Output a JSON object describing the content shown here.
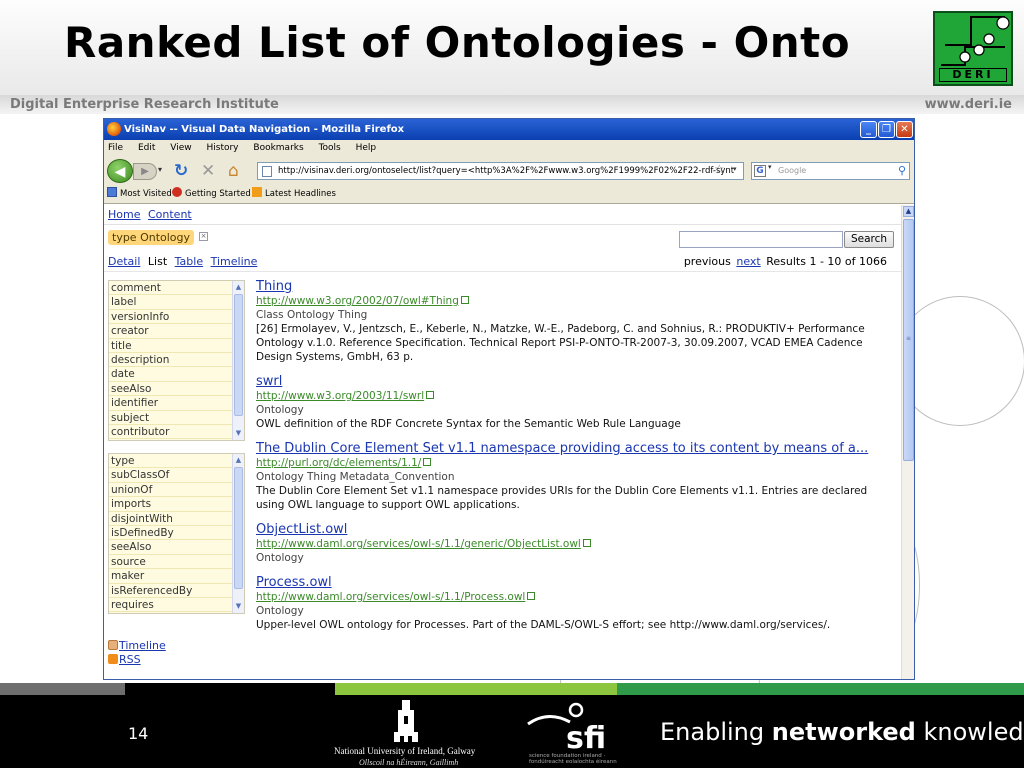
{
  "slide": {
    "title": "Ranked List of Ontologies - Onto",
    "institute": "Digital Enterprise Research Institute",
    "institute_url": "www.deri.ie",
    "logo_text": "DERI",
    "page_number": "14",
    "footer_tagline_pre": "Enabling ",
    "footer_tagline_bold": "networked",
    "footer_tagline_post": " knowledge.",
    "nui_name": "National University of Ireland, Galway",
    "nui_irish": "Ollscoil na hÉireann, Gaillimh",
    "sfi_text": "sfi",
    "sfi_tagline": "science foundation ireland · fondúireacht eolaíochta éireann",
    "colors": {
      "deri_green": "#1fa637",
      "stripe_grey": "#6e6e6e",
      "stripe_black": "#000000",
      "stripe_lime": "#8cc63f",
      "stripe_green": "#2f9a49",
      "footer_bg": "#000000"
    }
  },
  "browser": {
    "window_title": "VisiNav -- Visual Data Navigation - Mozilla Firefox",
    "menu": [
      "File",
      "Edit",
      "View",
      "History",
      "Bookmarks",
      "Tools",
      "Help"
    ],
    "url": "http://visinav.deri.org/ontoselect/list?query=<http%3A%2F%2Fwww.w3.org%2F1999%2F02%2F22-rdf-synt",
    "search_placeholder": "Google",
    "bookmarks": [
      "Most Visited",
      "Getting Started",
      "Latest Headlines"
    ],
    "icons": {
      "back": "back-arrow-icon",
      "forward": "forward-arrow-icon",
      "reload": "reload-icon",
      "stop": "stop-icon",
      "home": "home-icon",
      "bookmark_star": "star-icon",
      "search_engine": "google-icon",
      "search_go": "magnifier-icon"
    }
  },
  "page": {
    "nav": [
      "Home",
      "Content"
    ],
    "facet_chip": "type  Ontology",
    "search_button": "Search",
    "view_tabs": [
      "Detail",
      "List",
      "Table",
      "Timeline"
    ],
    "active_tab": "List",
    "pager": {
      "previous": "previous",
      "next": "next",
      "results": "Results 1 - 10 of 1066"
    },
    "properties_a": [
      "comment",
      "label",
      "versionInfo",
      "creator",
      "title",
      "description",
      "date",
      "seeAlso",
      "identifier",
      "subject",
      "contributor"
    ],
    "properties_b": [
      "type",
      "subClassOf",
      "unionOf",
      "imports",
      "disjointWith",
      "isDefinedBy",
      "seeAlso",
      "source",
      "maker",
      "isReferencedBy",
      "requires"
    ],
    "feeds": [
      "Timeline",
      "RSS"
    ],
    "results": [
      {
        "title": "Thing",
        "url": "http://www.w3.org/2002/07/owl#Thing",
        "types": "Class  Ontology  Thing",
        "description": "[26] Ermolayev, V., Jentzsch, E., Keberle, N., Matzke, W.-E., Padeborg, C. and Sohnius, R.: PRODUKTIV+ Performance Ontology v.1.0. Reference Specification. Technical Report PSI-P-ONTO-TR-2007-3, 30.09.2007, VCAD EMEA Cadence Design Systems, GmbH, 63 p."
      },
      {
        "title": "swrl",
        "url": "http://www.w3.org/2003/11/swrl",
        "types": "Ontology",
        "description": "OWL definition of the RDF Concrete Syntax for the Semantic Web Rule Language"
      },
      {
        "title": "The Dublin Core Element Set v1.1 namespace providing access to its content by means of a...",
        "url": "http://purl.org/dc/elements/1.1/",
        "types": "Ontology  Thing  Metadata_Convention",
        "description": "The Dublin Core Element Set v1.1 namespace provides URIs for the Dublin Core Elements v1.1. Entries are declared using OWL language to support OWL applications."
      },
      {
        "title": "ObjectList.owl",
        "url": "http://www.daml.org/services/owl-s/1.1/generic/ObjectList.owl",
        "types": "Ontology",
        "description": ""
      },
      {
        "title": "Process.owl",
        "url": "http://www.daml.org/services/owl-s/1.1/Process.owl",
        "types": "Ontology",
        "description": "Upper-level OWL ontology for Processes. Part of the DAML-S/OWL-S effort; see http://www.daml.org/services/."
      }
    ]
  }
}
